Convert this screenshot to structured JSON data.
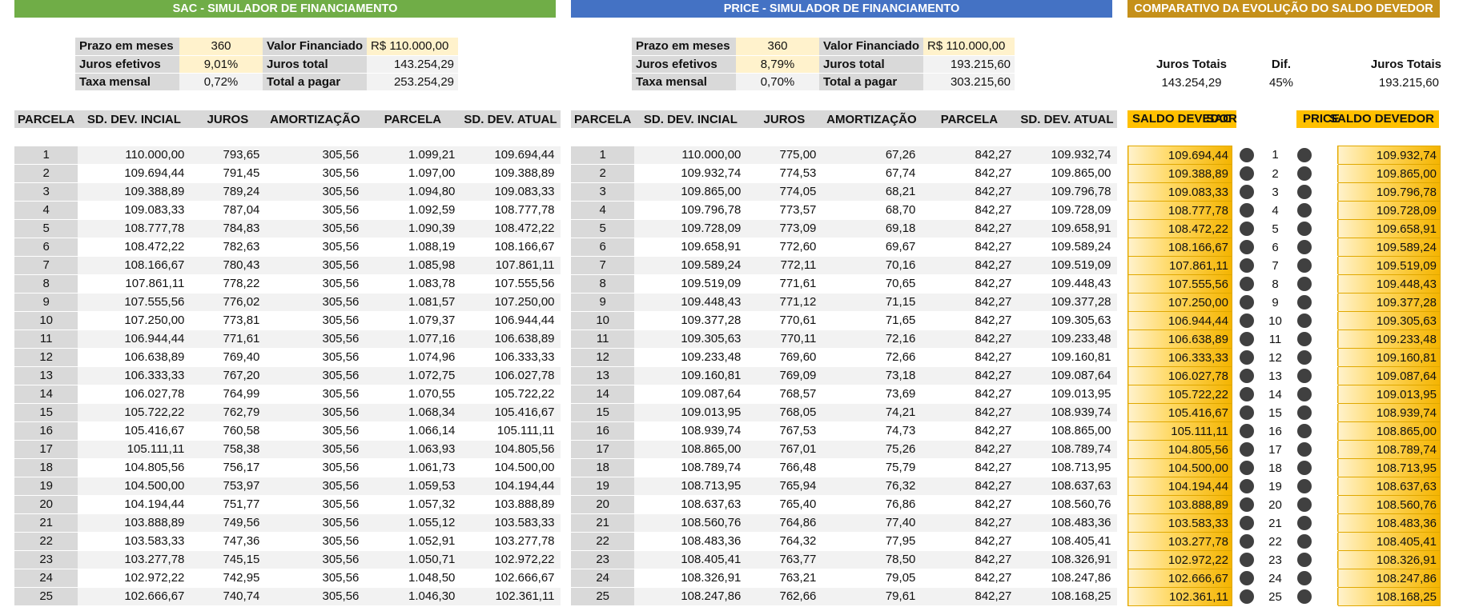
{
  "sac": {
    "title": "SAC - SIMULADOR DE FINANCIAMENTO",
    "summary": {
      "prazo_label": "Prazo em meses",
      "prazo_value": "360",
      "juros_ef_label": "Juros efetivos",
      "juros_ef_value": "9,01%",
      "taxa_label": "Taxa mensal",
      "taxa_value": "0,72%",
      "vf_label": "Valor Financiado",
      "vf_value": "R$  110.000,00",
      "juros_total_label": "Juros total",
      "juros_total_value": "143.254,29",
      "total_label": "Total a pagar",
      "total_value": "253.254,29"
    },
    "columns": [
      "PARCELA",
      "SD. DEV. INCIAL",
      "JUROS",
      "AMORTIZAÇÃO",
      "PARCELA",
      "SD. DEV. ATUAL"
    ],
    "rows": [
      [
        "1",
        "110.000,00",
        "793,65",
        "305,56",
        "1.099,21",
        "109.694,44"
      ],
      [
        "2",
        "109.694,44",
        "791,45",
        "305,56",
        "1.097,00",
        "109.388,89"
      ],
      [
        "3",
        "109.388,89",
        "789,24",
        "305,56",
        "1.094,80",
        "109.083,33"
      ],
      [
        "4",
        "109.083,33",
        "787,04",
        "305,56",
        "1.092,59",
        "108.777,78"
      ],
      [
        "5",
        "108.777,78",
        "784,83",
        "305,56",
        "1.090,39",
        "108.472,22"
      ],
      [
        "6",
        "108.472,22",
        "782,63",
        "305,56",
        "1.088,19",
        "108.166,67"
      ],
      [
        "7",
        "108.166,67",
        "780,43",
        "305,56",
        "1.085,98",
        "107.861,11"
      ],
      [
        "8",
        "107.861,11",
        "778,22",
        "305,56",
        "1.083,78",
        "107.555,56"
      ],
      [
        "9",
        "107.555,56",
        "776,02",
        "305,56",
        "1.081,57",
        "107.250,00"
      ],
      [
        "10",
        "107.250,00",
        "773,81",
        "305,56",
        "1.079,37",
        "106.944,44"
      ],
      [
        "11",
        "106.944,44",
        "771,61",
        "305,56",
        "1.077,16",
        "106.638,89"
      ],
      [
        "12",
        "106.638,89",
        "769,40",
        "305,56",
        "1.074,96",
        "106.333,33"
      ],
      [
        "13",
        "106.333,33",
        "767,20",
        "305,56",
        "1.072,75",
        "106.027,78"
      ],
      [
        "14",
        "106.027,78",
        "764,99",
        "305,56",
        "1.070,55",
        "105.722,22"
      ],
      [
        "15",
        "105.722,22",
        "762,79",
        "305,56",
        "1.068,34",
        "105.416,67"
      ],
      [
        "16",
        "105.416,67",
        "760,58",
        "305,56",
        "1.066,14",
        "105.111,11"
      ],
      [
        "17",
        "105.111,11",
        "758,38",
        "305,56",
        "1.063,93",
        "104.805,56"
      ],
      [
        "18",
        "104.805,56",
        "756,17",
        "305,56",
        "1.061,73",
        "104.500,00"
      ],
      [
        "19",
        "104.500,00",
        "753,97",
        "305,56",
        "1.059,53",
        "104.194,44"
      ],
      [
        "20",
        "104.194,44",
        "751,77",
        "305,56",
        "1.057,32",
        "103.888,89"
      ],
      [
        "21",
        "103.888,89",
        "749,56",
        "305,56",
        "1.055,12",
        "103.583,33"
      ],
      [
        "22",
        "103.583,33",
        "747,36",
        "305,56",
        "1.052,91",
        "103.277,78"
      ],
      [
        "23",
        "103.277,78",
        "745,15",
        "305,56",
        "1.050,71",
        "102.972,22"
      ],
      [
        "24",
        "102.972,22",
        "742,95",
        "305,56",
        "1.048,50",
        "102.666,67"
      ],
      [
        "25",
        "102.666,67",
        "740,74",
        "305,56",
        "1.046,30",
        "102.361,11"
      ]
    ]
  },
  "price": {
    "title": "PRICE - SIMULADOR DE FINANCIAMENTO",
    "summary": {
      "prazo_label": "Prazo em meses",
      "prazo_value": "360",
      "juros_ef_label": "Juros efetivos",
      "juros_ef_value": "8,79%",
      "taxa_label": "Taxa mensal",
      "taxa_value": "0,70%",
      "vf_label": "Valor Financiado",
      "vf_value": "R$  110.000,00",
      "juros_total_label": "Juros total",
      "juros_total_value": "193.215,60",
      "total_label": "Total a pagar",
      "total_value": "303.215,60"
    },
    "columns": [
      "PARCELA",
      "SD. DEV. INCIAL",
      "JUROS",
      "AMORTIZAÇÃO",
      "PARCELA",
      "SD. DEV. ATUAL"
    ],
    "rows": [
      [
        "1",
        "110.000,00",
        "775,00",
        "67,26",
        "842,27",
        "109.932,74"
      ],
      [
        "2",
        "109.932,74",
        "774,53",
        "67,74",
        "842,27",
        "109.865,00"
      ],
      [
        "3",
        "109.865,00",
        "774,05",
        "68,21",
        "842,27",
        "109.796,78"
      ],
      [
        "4",
        "109.796,78",
        "773,57",
        "68,70",
        "842,27",
        "109.728,09"
      ],
      [
        "5",
        "109.728,09",
        "773,09",
        "69,18",
        "842,27",
        "109.658,91"
      ],
      [
        "6",
        "109.658,91",
        "772,60",
        "69,67",
        "842,27",
        "109.589,24"
      ],
      [
        "7",
        "109.589,24",
        "772,11",
        "70,16",
        "842,27",
        "109.519,09"
      ],
      [
        "8",
        "109.519,09",
        "771,61",
        "70,65",
        "842,27",
        "109.448,43"
      ],
      [
        "9",
        "109.448,43",
        "771,12",
        "71,15",
        "842,27",
        "109.377,28"
      ],
      [
        "10",
        "109.377,28",
        "770,61",
        "71,65",
        "842,27",
        "109.305,63"
      ],
      [
        "11",
        "109.305,63",
        "770,11",
        "72,16",
        "842,27",
        "109.233,48"
      ],
      [
        "12",
        "109.233,48",
        "769,60",
        "72,66",
        "842,27",
        "109.160,81"
      ],
      [
        "13",
        "109.160,81",
        "769,09",
        "73,18",
        "842,27",
        "109.087,64"
      ],
      [
        "14",
        "109.087,64",
        "768,57",
        "73,69",
        "842,27",
        "109.013,95"
      ],
      [
        "15",
        "109.013,95",
        "768,05",
        "74,21",
        "842,27",
        "108.939,74"
      ],
      [
        "16",
        "108.939,74",
        "767,53",
        "74,73",
        "842,27",
        "108.865,00"
      ],
      [
        "17",
        "108.865,00",
        "767,01",
        "75,26",
        "842,27",
        "108.789,74"
      ],
      [
        "18",
        "108.789,74",
        "766,48",
        "75,79",
        "842,27",
        "108.713,95"
      ],
      [
        "19",
        "108.713,95",
        "765,94",
        "76,32",
        "842,27",
        "108.637,63"
      ],
      [
        "20",
        "108.637,63",
        "765,40",
        "76,86",
        "842,27",
        "108.560,76"
      ],
      [
        "21",
        "108.560,76",
        "764,86",
        "77,40",
        "842,27",
        "108.483,36"
      ],
      [
        "22",
        "108.483,36",
        "764,32",
        "77,95",
        "842,27",
        "108.405,41"
      ],
      [
        "23",
        "108.405,41",
        "763,77",
        "78,50",
        "842,27",
        "108.326,91"
      ],
      [
        "24",
        "108.326,91",
        "763,21",
        "79,05",
        "842,27",
        "108.247,86"
      ],
      [
        "25",
        "108.247,86",
        "762,66",
        "79,61",
        "842,27",
        "108.168,25"
      ]
    ]
  },
  "comparativo": {
    "title": "COMPARATIVO DA EVOLUÇÃO DO SALDO DEVEDOR",
    "juros_totais_label_sac": "Juros Totais",
    "dif_label": "Dif.",
    "juros_totais_label_price": "Juros Totais",
    "juros_totais_sac": "143.254,29",
    "dif_value": "45%",
    "juros_totais_price": "193.215,60",
    "head_sac_a": "SALDO DEVEDOR",
    "head_sac_b": "SAC",
    "head_price_a": "PRICE",
    "head_price_b": "SALDO DEVEDOR"
  },
  "colors": {
    "sac_banner": "#70ad47",
    "price_banner": "#4472c4",
    "comp_banner": "#c5901a",
    "header_gray": "#d9d9d9",
    "input_yellow": "#fff2cc",
    "bar_gold": "#ffc000"
  },
  "icons": {
    "row_marker": "dark-circle-icon"
  }
}
